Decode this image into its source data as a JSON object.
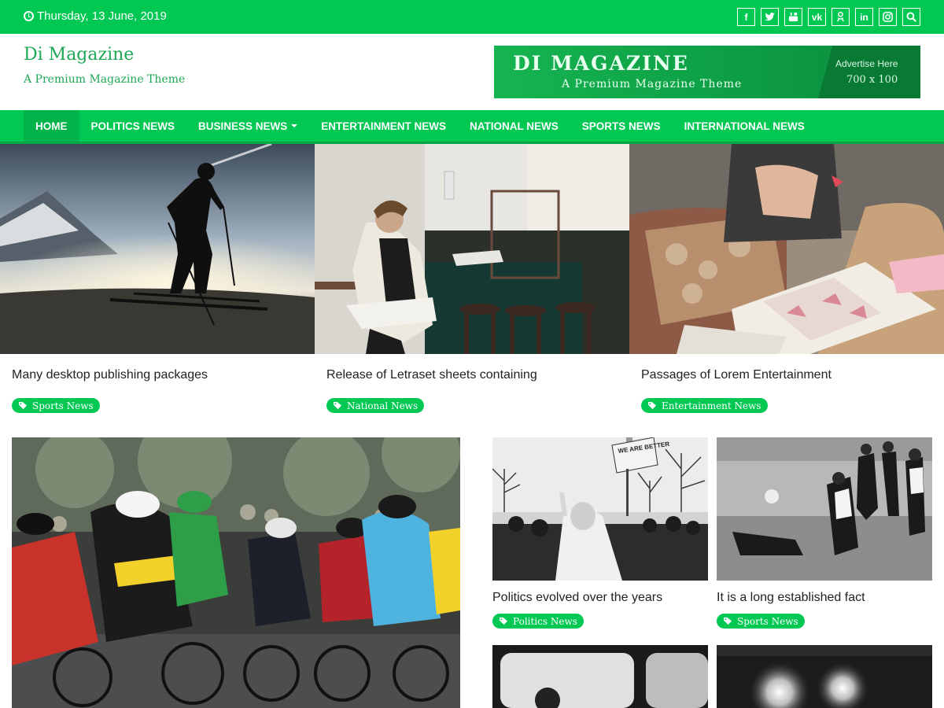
{
  "topbar": {
    "date": "Thursday, 13 June, 2019",
    "socials": [
      {
        "icon": "facebook-icon",
        "glyph": "f"
      },
      {
        "icon": "twitter-icon",
        "glyph": ""
      },
      {
        "icon": "youtube-icon",
        "glyph": ""
      },
      {
        "icon": "vk-icon",
        "glyph": "vk"
      },
      {
        "icon": "odnoklassniki-icon",
        "glyph": ""
      },
      {
        "icon": "linkedin-icon",
        "glyph": "in"
      },
      {
        "icon": "instagram-icon",
        "glyph": ""
      },
      {
        "icon": "search-icon",
        "glyph": ""
      }
    ]
  },
  "header": {
    "site_title": "Di Magazine",
    "tagline": "A Premium Magazine Theme",
    "ad": {
      "title": "Di Magazine",
      "subtitle": "A Premium Magazine Theme",
      "advertise": "Advertise Here",
      "size": "700 x 100"
    }
  },
  "nav": {
    "items": [
      {
        "label": "HOME",
        "active": true
      },
      {
        "label": "POLITICS NEWS"
      },
      {
        "label": "BUSINESS NEWS",
        "dropdown": true
      },
      {
        "label": "ENTERTAINMENT NEWS"
      },
      {
        "label": "NATIONAL NEWS"
      },
      {
        "label": "SPORTS NEWS"
      },
      {
        "label": "INTERNATIONAL NEWS"
      }
    ]
  },
  "slider": [
    {
      "title": "Many desktop publishing packages",
      "tag": "Sports News"
    },
    {
      "title": "Release of Letraset sheets containing",
      "tag": "National News"
    },
    {
      "title": "Passages of Lorem Entertainment",
      "tag": "Entertainment News"
    }
  ],
  "grid": [
    {
      "title": "Politics evolved over the years",
      "tag": "Politics News"
    },
    {
      "title": "It is a long established fact",
      "tag": "Sports News"
    }
  ],
  "photo_text": {
    "protest_sign": "WE ARE BETTER THAN THIS!"
  },
  "colors": {
    "brand_green": "#00c853",
    "title_green": "#1fa855"
  }
}
